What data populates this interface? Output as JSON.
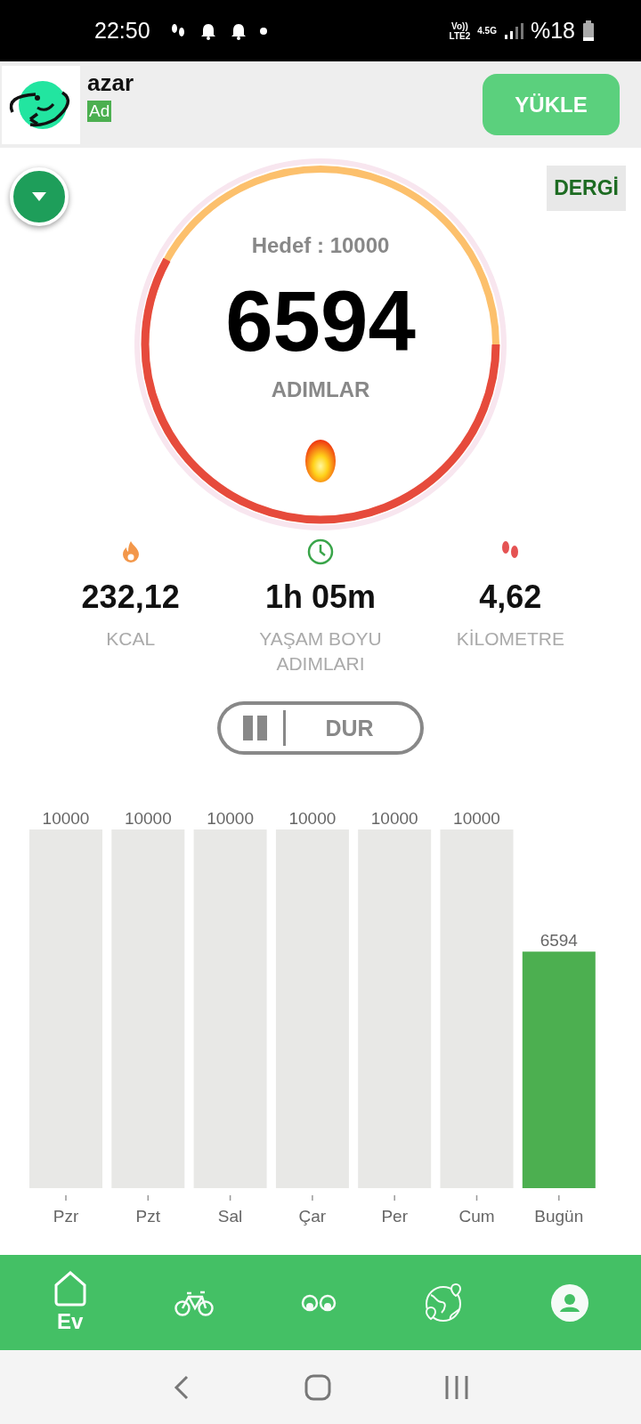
{
  "status_bar": {
    "time": "22:50",
    "volte": "Vo))",
    "lte": "LTE2",
    "network": "4.5G",
    "battery": "%18"
  },
  "ad": {
    "app_name": "azar",
    "badge": "Ad",
    "button": "YÜKLE"
  },
  "magazine_button": "DERGİ",
  "goal": {
    "label": "Hedef : 10000",
    "steps": "6594",
    "unit": "ADIMLAR",
    "level": 0.66
  },
  "stats": [
    {
      "kind": "calories",
      "value": "232,12",
      "label": "KCAL"
    },
    {
      "kind": "time",
      "value": "1h 05m",
      "label": "YAŞAM BOYU ADIMLARI"
    },
    {
      "kind": "distance",
      "value": "4,62",
      "label": "KİLOMETRE"
    }
  ],
  "stop_button": {
    "label": "DUR"
  },
  "weekly": {
    "chart_data": {
      "type": "bar",
      "categories": [
        "Pzr",
        "Pzt",
        "Sal",
        "Çar",
        "Per",
        "Cum",
        "Bugün"
      ],
      "series": [
        {
          "color": "#e8e8e6",
          "values": [
            10000,
            10000,
            10000,
            10000,
            10000,
            10000,
            null
          ]
        },
        {
          "color": "#4caf50",
          "values": [
            null,
            null,
            null,
            null,
            null,
            null,
            6594
          ]
        }
      ],
      "stacked": true,
      "data_labels": true
    }
  },
  "bottom_nav": [
    {
      "kind": "home",
      "label": "Ev",
      "selected": true
    },
    {
      "kind": "bike",
      "selected": false
    },
    {
      "kind": "glasses",
      "selected": false
    },
    {
      "kind": "globe",
      "selected": false
    },
    {
      "kind": "profile",
      "selected": false
    }
  ]
}
